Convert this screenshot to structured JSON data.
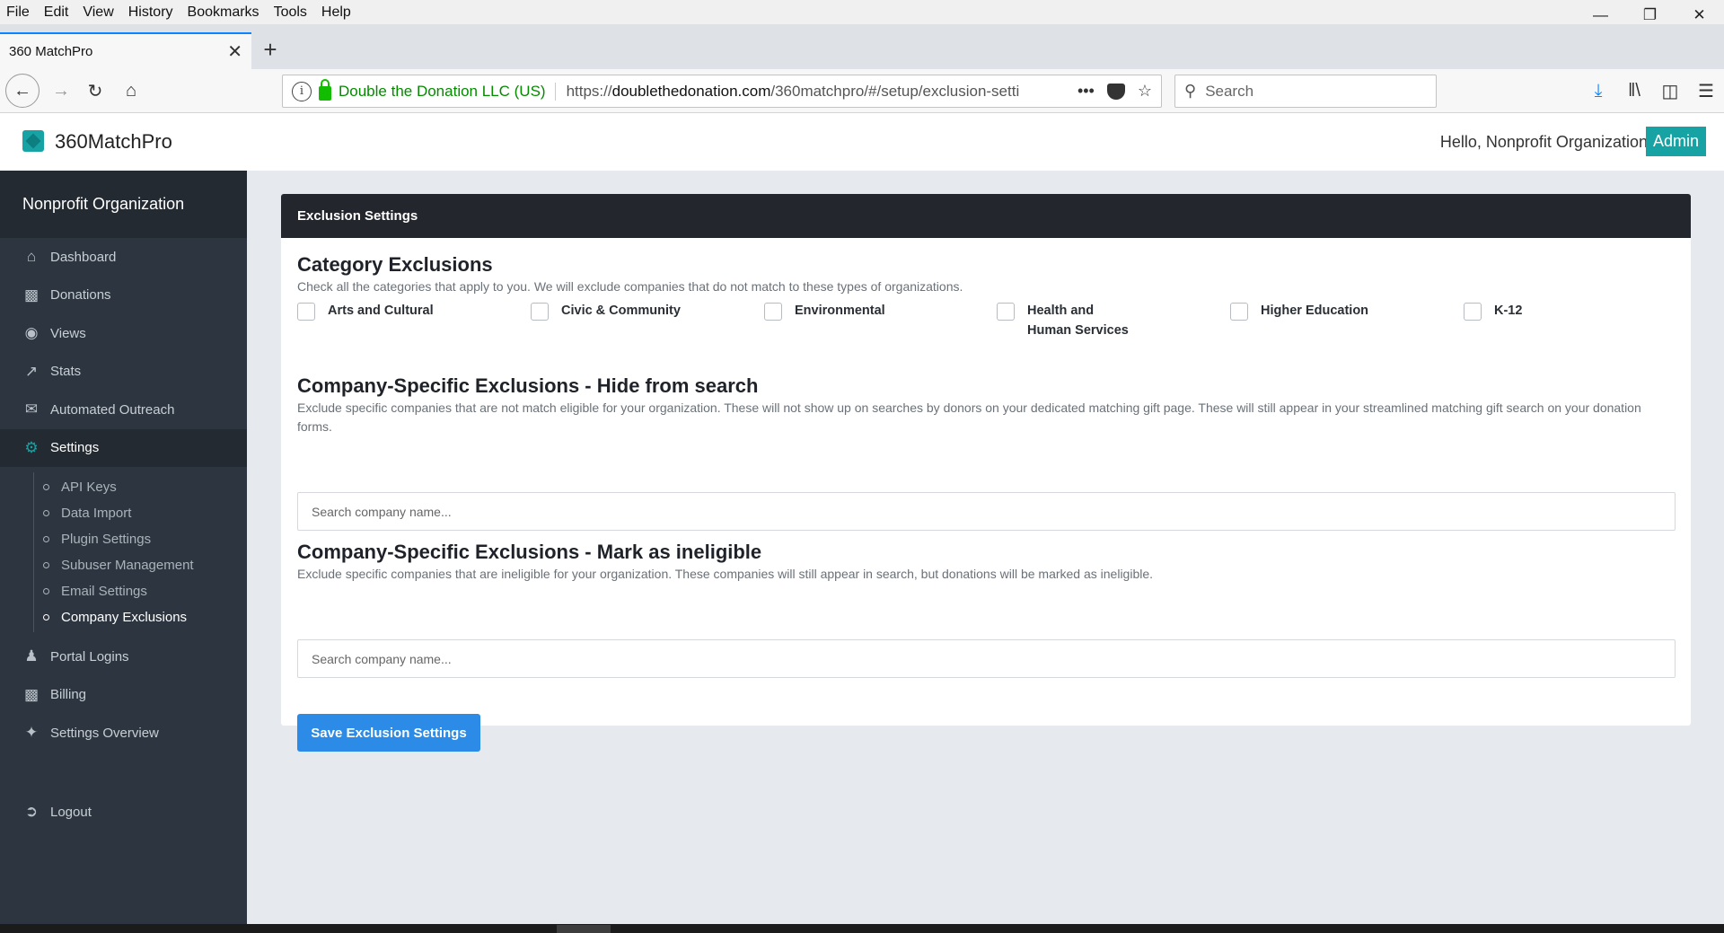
{
  "browser": {
    "menu": [
      "File",
      "Edit",
      "View",
      "History",
      "Bookmarks",
      "Tools",
      "Help"
    ],
    "tab_title": "360 MatchPro",
    "site_identity": "Double the Donation LLC (US)",
    "url_prefix": "https://",
    "url_host": "doublethedonation.com",
    "url_path": "/360matchpro/#/setup/exclusion-setti",
    "search_placeholder": "Search",
    "colors": {
      "accent": "#0a84ff",
      "secure": "#058b00"
    }
  },
  "header": {
    "app_name": "360MatchPro",
    "greeting": "Hello, Nonprofit Organization",
    "role_badge": "Admin",
    "brand_color": "#17a2a4"
  },
  "sidebar": {
    "org_name": "Nonprofit Organization",
    "items": [
      {
        "label": "Dashboard",
        "icon": "home-icon"
      },
      {
        "label": "Donations",
        "icon": "money-icon"
      },
      {
        "label": "Views",
        "icon": "eye-icon"
      },
      {
        "label": "Stats",
        "icon": "chart-icon"
      },
      {
        "label": "Automated Outreach",
        "icon": "envelope-icon"
      },
      {
        "label": "Settings",
        "icon": "gears-icon"
      }
    ],
    "settings_subitems": [
      "API Keys",
      "Data Import",
      "Plugin Settings",
      "Subuser Management",
      "Email Settings",
      "Company Exclusions"
    ],
    "items_after": [
      {
        "label": "Portal Logins",
        "icon": "user-icon"
      },
      {
        "label": "Billing",
        "icon": "money-icon"
      },
      {
        "label": "Settings Overview",
        "icon": "wrench-icon"
      }
    ],
    "logout": "Logout"
  },
  "main": {
    "card_title": "Exclusion Settings",
    "category": {
      "title": "Category Exclusions",
      "description": "Check all the categories that apply to you. We will exclude companies that do not match to these types of organizations.",
      "options": [
        "Arts and Cultural",
        "Civic & Community",
        "Environmental",
        "Health and Human Services",
        "Higher Education",
        "K-12"
      ]
    },
    "hide_section": {
      "title": "Company-Specific Exclusions - Hide from search",
      "description": "Exclude specific companies that are not match eligible for your organization. These will not show up on searches by donors on your dedicated matching gift page. These will still appear in your streamlined matching gift search on your donation forms.",
      "placeholder": "Search company name..."
    },
    "ineligible_section": {
      "title": "Company-Specific Exclusions - Mark as ineligible",
      "description": "Exclude specific companies that are ineligible for your organization. These companies will still appear in search, but donations will be marked as ineligible.",
      "placeholder": "Search company name..."
    },
    "save_label": "Save Exclusion Settings",
    "save_color": "#2b8be6"
  }
}
